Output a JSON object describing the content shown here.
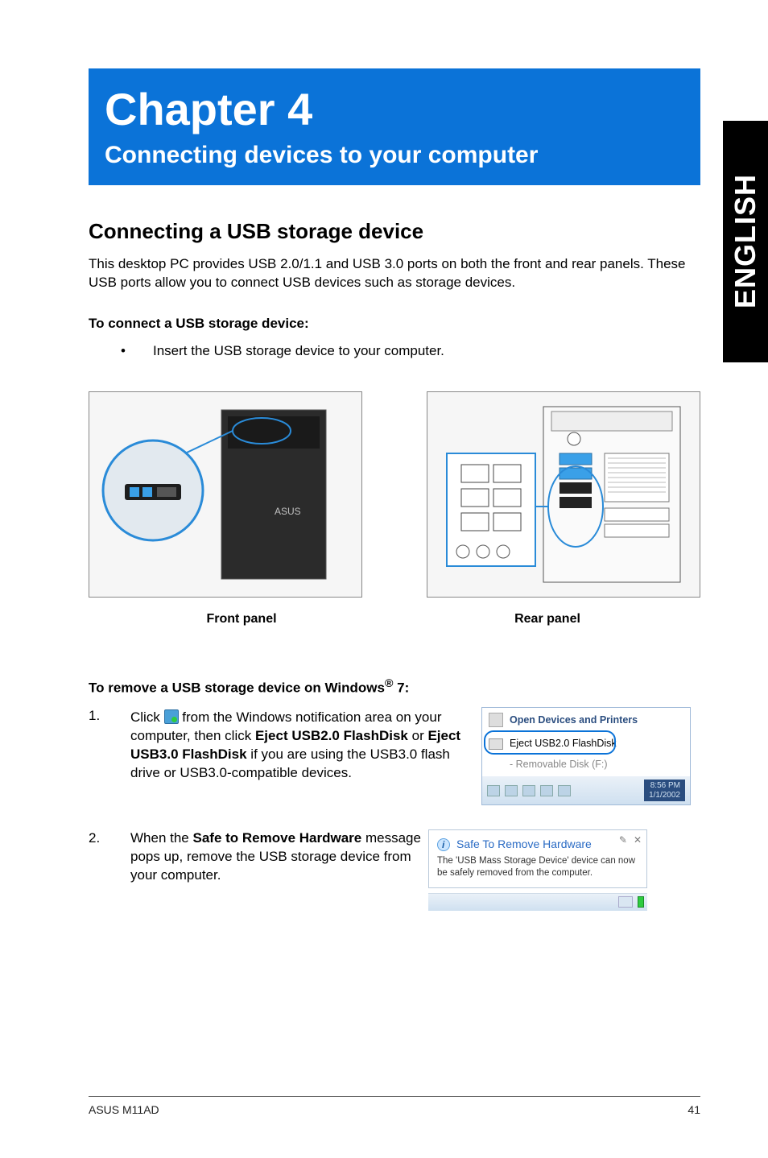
{
  "language_tab": "ENGLISH",
  "chapter": {
    "title": "Chapter 4",
    "subtitle": "Connecting devices to your computer"
  },
  "section": {
    "heading": "Connecting a USB storage device",
    "intro": "This desktop PC provides USB 2.0/1.1 and USB 3.0 ports on both the front and rear panels. These USB ports allow you to connect USB devices such as storage devices.",
    "connect_heading": "To connect a USB storage device:",
    "connect_bullet": "Insert the USB storage device to your computer.",
    "front_label": "Front panel",
    "rear_label": "Rear panel",
    "remove_heading_a": "To remove a USB storage device on Windows",
    "remove_heading_sup": "®",
    "remove_heading_b": " 7:",
    "step1_a": "Click ",
    "step1_b": " from the Windows notification area on your computer, then click ",
    "step1_bold1": "Eject USB2.0 FlashDisk",
    "step1_c": " or ",
    "step1_bold2": "Eject USB3.0 FlashDisk",
    "step1_d": " if you are using the USB3.0 flash drive or USB3.0-compatible devices.",
    "step2_a": "When the ",
    "step2_bold": "Safe to Remove Hardware",
    "step2_b": " message pops up, remove the USB storage device from your computer."
  },
  "eject_menu": {
    "open_devices": "Open Devices and Printers",
    "eject_item": "Eject USB2.0 FlashDisk",
    "sub_item": "-   Removable Disk (F:)",
    "time": "8:56 PM",
    "date": "1/1/2002"
  },
  "balloon": {
    "title": "Safe To Remove Hardware",
    "body": "The 'USB Mass Storage Device' device can now be safely removed from the computer.",
    "pin": "✎",
    "close": "✕"
  },
  "footer": {
    "left": "ASUS M11AD",
    "right": "41"
  }
}
